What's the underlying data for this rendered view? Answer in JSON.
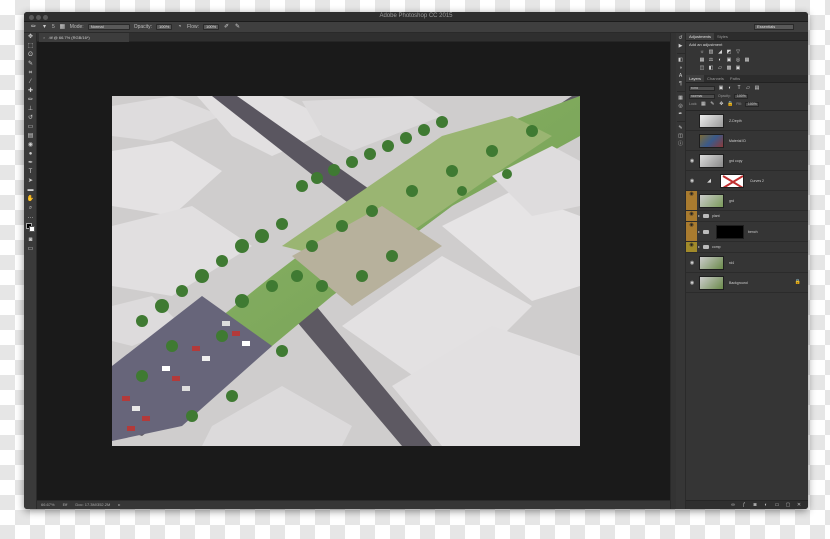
{
  "window": {
    "title": "Adobe Photoshop CC 2015"
  },
  "options_bar": {
    "tool_icon": "brush-icon",
    "brush_size": "5",
    "mode_label": "Mode:",
    "mode_value": "Normal",
    "opacity_label": "Opacity:",
    "opacity_value": "100%",
    "flow_label": "Flow:",
    "flow_value": "100%",
    "workspace": "Essentials"
  },
  "document_tab": {
    "close": "×",
    "label": ".tif @ 66.7% (RGB/16*)"
  },
  "status_bar": {
    "zoom": "66.67%",
    "mode": "Eff",
    "doc_size": "Doc: 17.3M/352.2M",
    "arrow": "▸"
  },
  "tools": [
    {
      "name": "move-tool-icon",
      "glyph": "✥"
    },
    {
      "name": "marquee-tool-icon",
      "glyph": "⬚"
    },
    {
      "name": "lasso-tool-icon",
      "glyph": "ʘ"
    },
    {
      "name": "quick-select-tool-icon",
      "glyph": "✎"
    },
    {
      "name": "crop-tool-icon",
      "glyph": "⌗"
    },
    {
      "name": "eyedropper-tool-icon",
      "glyph": "⁄"
    },
    {
      "name": "healing-tool-icon",
      "glyph": "✚"
    },
    {
      "name": "brush-tool-icon",
      "glyph": "✏"
    },
    {
      "name": "stamp-tool-icon",
      "glyph": "⊥"
    },
    {
      "name": "history-brush-icon",
      "glyph": "↺"
    },
    {
      "name": "eraser-tool-icon",
      "glyph": "▭"
    },
    {
      "name": "gradient-tool-icon",
      "glyph": "▤"
    },
    {
      "name": "blur-tool-icon",
      "glyph": "◉"
    },
    {
      "name": "dodge-tool-icon",
      "glyph": "●"
    },
    {
      "name": "pen-tool-icon",
      "glyph": "✒"
    },
    {
      "name": "type-tool-icon",
      "glyph": "T"
    },
    {
      "name": "path-select-tool-icon",
      "glyph": "➤"
    },
    {
      "name": "shape-tool-icon",
      "glyph": "▬"
    },
    {
      "name": "hand-tool-icon",
      "glyph": "✋"
    },
    {
      "name": "zoom-tool-icon",
      "glyph": "⌕"
    },
    {
      "name": "more-tools-icon",
      "glyph": "…"
    }
  ],
  "icon_strip": [
    "history-icon",
    "actions-icon",
    "properties-icon",
    "adjust-icon",
    "char-icon",
    "para-icon",
    "swatch-icon",
    "channels-icon",
    "paths-icon",
    "brush-panel-icon",
    "layers-icon",
    "info-icon"
  ],
  "adjustments_panel": {
    "tabs": [
      "Adjustments",
      "Styles"
    ],
    "title": "Add an adjustment",
    "row1": [
      "☼",
      "▥",
      "◢",
      "◩",
      "▽"
    ],
    "row2": [
      "▦",
      "⚖",
      "◐",
      "▣",
      "◎",
      "▦"
    ],
    "row3": [
      "◫",
      "◧",
      "▱",
      "▩",
      "▣"
    ]
  },
  "layers_panel": {
    "tabs": [
      "Layers",
      "Channels",
      "Paths"
    ],
    "kind_filter": "Kind",
    "blend_mode": "Normal",
    "opacity_label": "Opacity:",
    "opacity_value": "100%",
    "lock_label": "Lock:",
    "fill_label": "Fill:",
    "fill_value": "100%",
    "layers": [
      {
        "name": "Z-Depth",
        "visible": false,
        "type": "layer"
      },
      {
        "name": "Material ID",
        "visible": false,
        "type": "layer"
      },
      {
        "name": "grd copy",
        "visible": true,
        "type": "layer"
      },
      {
        "name": "Curves 2",
        "visible": true,
        "type": "adjustment"
      },
      {
        "name": "grd",
        "visible": true,
        "type": "layer",
        "tag": "orange"
      },
      {
        "name": "plant",
        "visible": true,
        "type": "group",
        "tag": "orange"
      },
      {
        "name": "bench",
        "visible": true,
        "type": "masked-group",
        "tag": "orange"
      },
      {
        "name": "comp",
        "visible": true,
        "type": "group",
        "tag": "yellow"
      },
      {
        "name": "rd4",
        "visible": true,
        "type": "layer"
      },
      {
        "name": "Background",
        "visible": true,
        "type": "background",
        "locked": true
      }
    ]
  },
  "colors": {
    "ui_dark": "#3d3d3d",
    "canvas_bg": "#1a1a1a",
    "tag_orange": "#a97b2f",
    "tag_yellow": "#a18a2a"
  }
}
